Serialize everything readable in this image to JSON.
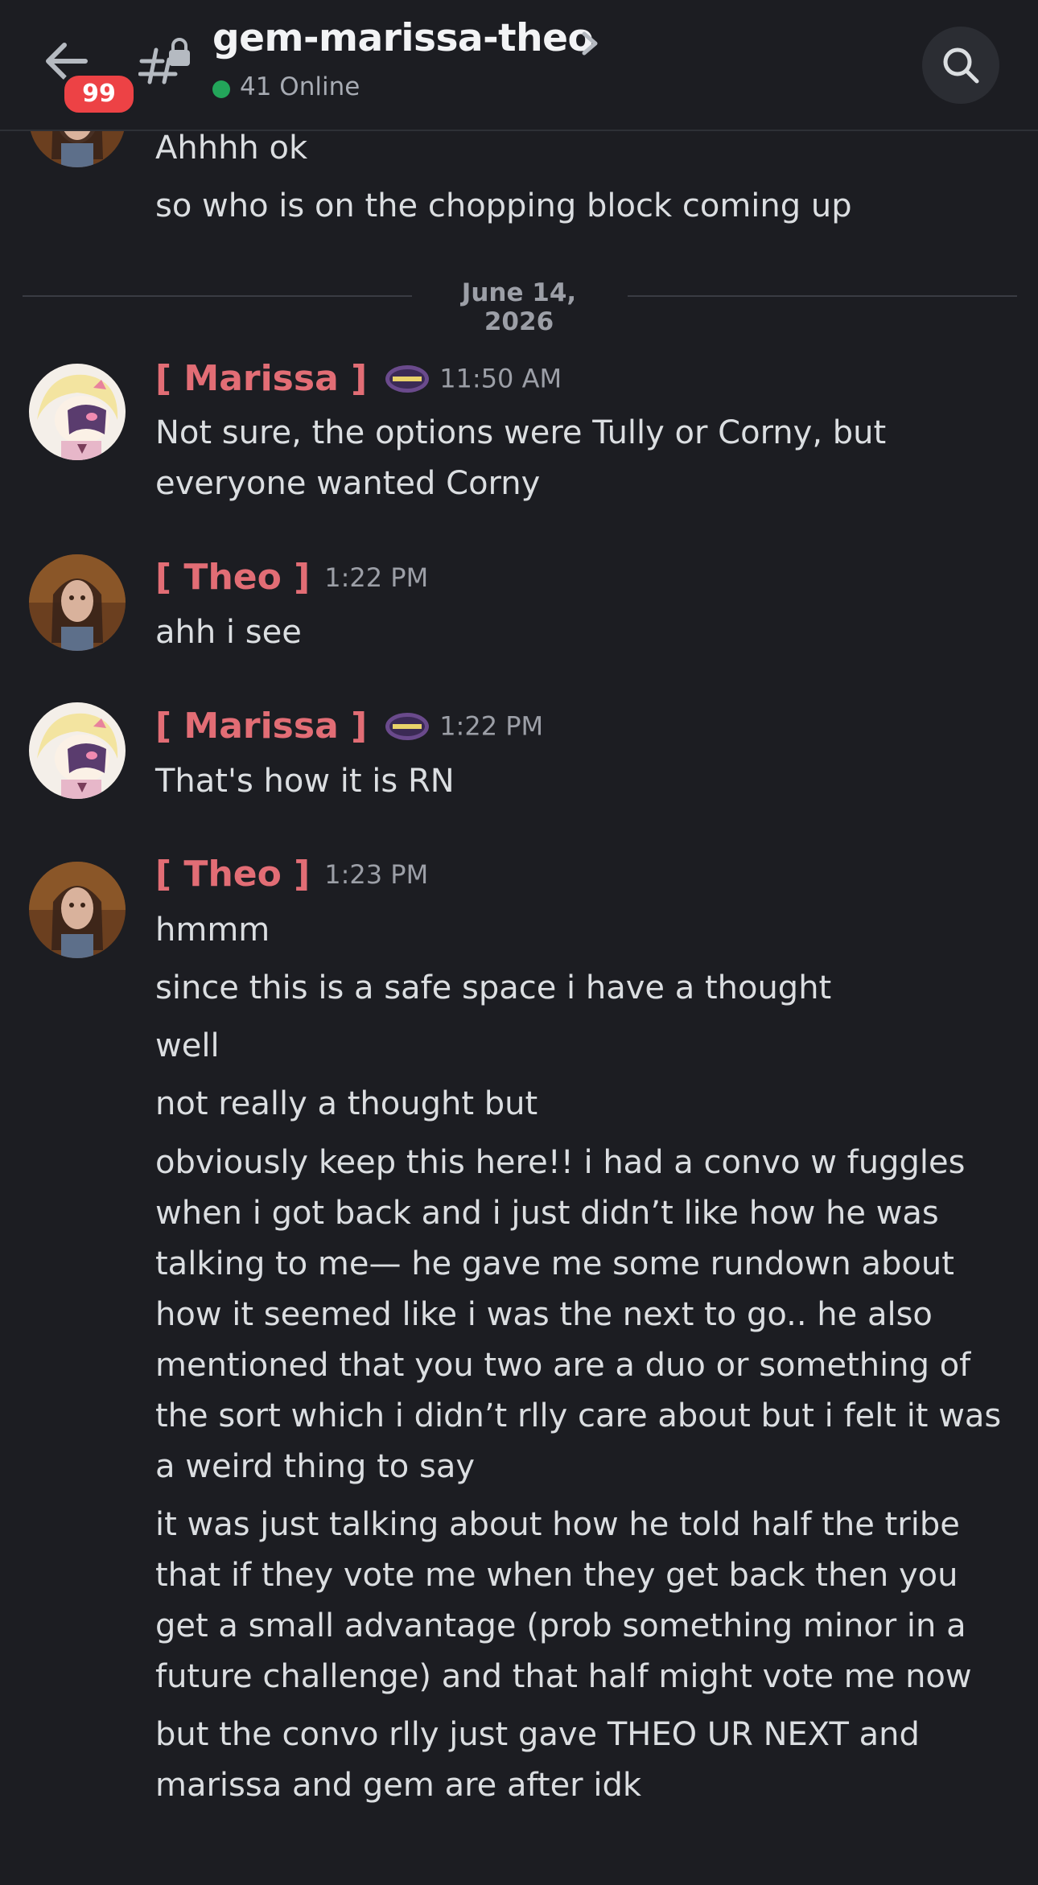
{
  "header": {
    "back_icon": "arrow-left-icon",
    "unread_badge": "99",
    "channel_icon": "locked-hashtag-icon",
    "channel_name": "gem-marissa-theo",
    "online_text": "41 Online",
    "search_icon": "search-icon",
    "accent_online": "#23a55a",
    "badge_color": "#ed4245"
  },
  "messages_top": {
    "lines": [
      "Ahhhh ok",
      "so who is on the chopping block coming up"
    ]
  },
  "date_divider": "June 14, 2026",
  "messages": [
    {
      "author": "[ Marissa ]",
      "time": "11:50 AM",
      "lines": [
        "Not sure, the options were Tully or Corny, but",
        "everyone wanted Corny"
      ]
    },
    {
      "author": "[ Theo ]",
      "time": "1:22 PM",
      "lines": [
        "ahh i see"
      ]
    },
    {
      "author": "[ Marissa ]",
      "time": "1:22 PM",
      "lines": [
        "That's how it is RN"
      ]
    },
    {
      "author": "[ Theo ]",
      "time": "1:23 PM",
      "lines": [
        "hmmm",
        "since this is a safe space i have a thought",
        "well",
        "not really a thought but",
        "obviously keep this here!! i had a convo w fuggles",
        "when i got back and i just didn’t like how he was",
        "talking to me— he gave me some rundown about",
        "how it seemed like i was the next to go.. he also",
        "mentioned that you two are a duo or something of",
        "the sort which i didn’t rlly care about but i felt it was",
        "a weird thing to say",
        "it was just talking about how he told half the tribe",
        "that if they vote me when they get back then you",
        "get a small advantage (prob something minor in a",
        "future challenge) and that half might vote me now",
        "but the convo rlly just gave THEO UR NEXT and",
        "marissa and gem are after idk"
      ]
    }
  ],
  "author_color": "#e26d75"
}
